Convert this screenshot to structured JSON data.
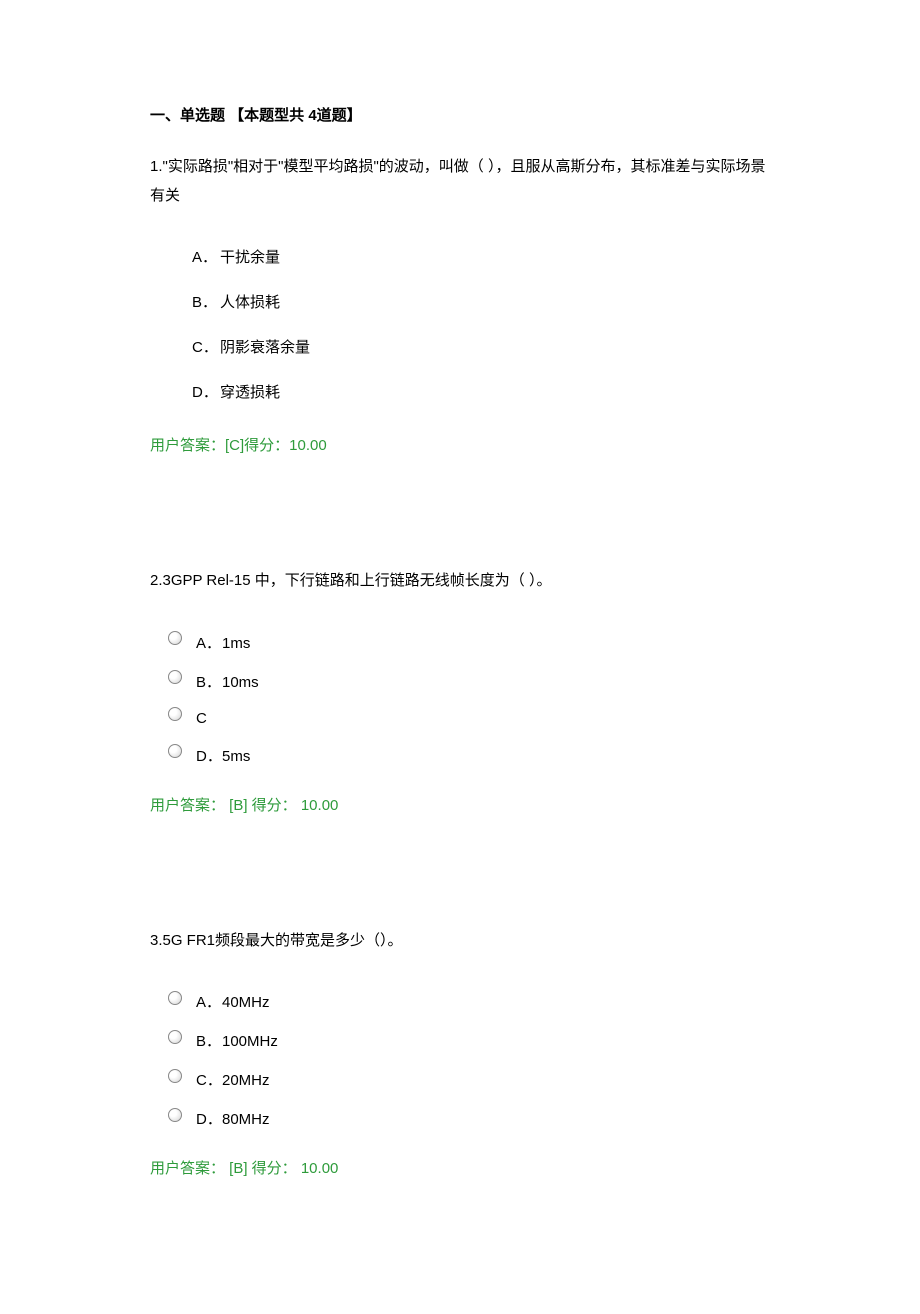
{
  "section_title": "一、单选题 【本题型共 4道题】",
  "questions": [
    {
      "stem": "1.\"实际路损\"相对于\"模型平均路损\"的波动，叫做（ ），且服从高斯分布，其标准差与实际场景有关",
      "style": "plain",
      "options": [
        {
          "letter": "A．",
          "text": "干扰余量"
        },
        {
          "letter": "B．",
          "text": "人体损耗"
        },
        {
          "letter": "C．",
          "text": "阴影衰落余量"
        },
        {
          "letter": "D．",
          "text": "穿透损耗"
        }
      ],
      "answer": "用户答案：[C]得分：10.00"
    },
    {
      "stem": "2.3GPP Rel-15 中，下行链路和上行链路无线帧长度为（ ）。",
      "style": "radio",
      "options": [
        {
          "letter": "A．",
          "text": "1ms"
        },
        {
          "letter": "B．",
          "text": "10ms"
        },
        {
          "letter": "C",
          "text": ""
        },
        {
          "letter": "D．",
          "text": "5ms"
        }
      ],
      "answer": "用户答案： [B] 得分： 10.00"
    },
    {
      "stem": "3.5G FR1频段最大的带宽是多少（）。",
      "style": "radio",
      "options": [
        {
          "letter": "A．",
          "text": "40MHz"
        },
        {
          "letter": "B．",
          "text": "100MHz"
        },
        {
          "letter": "C．",
          "text": "20MHz"
        },
        {
          "letter": "D．",
          "text": "80MHz"
        }
      ],
      "answer": "用户答案： [B] 得分： 10.00"
    }
  ]
}
